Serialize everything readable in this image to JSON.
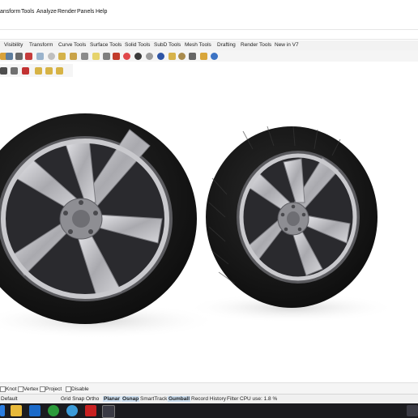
{
  "menu": {
    "items": [
      "ansform",
      "Tools",
      "Analyze",
      "Render",
      "Panels",
      "Help"
    ]
  },
  "toolbar_tabs": {
    "items": [
      "Visibility",
      "Transform",
      "Curve Tools",
      "Surface Tools",
      "Solid Tools",
      "SubD Tools",
      "Mesh Tools",
      "Drafting",
      "Render Tools",
      "New in V7"
    ]
  },
  "osnap": {
    "knot": "Knot",
    "vertex": "Vertex",
    "project": "Project",
    "disable": "Disable"
  },
  "status": {
    "layer": "Default",
    "grid_snap": "Grid Snap",
    "ortho": "Ortho",
    "planar": "Planar",
    "osnap": "Osnap",
    "smarttrack": "SmartTrack",
    "gumball": "Gumball",
    "record_history": "Record History",
    "filter": "Filter",
    "cpu": "CPU use: 1.8 %"
  },
  "colors": {
    "viewport_bg": "#ffffff",
    "tire": "#1a1a1a",
    "rim_metal": "#b8b8bc",
    "rim_dark": "#3a3a3e",
    "taskbar": "#1b1b1f"
  },
  "taskbar_icons": [
    "edge-icon",
    "file-explorer-icon",
    "outlook-icon",
    "xbox-icon",
    "chrome-icon",
    "windows-security-icon",
    "acrobat-icon",
    "rhino-icon"
  ]
}
